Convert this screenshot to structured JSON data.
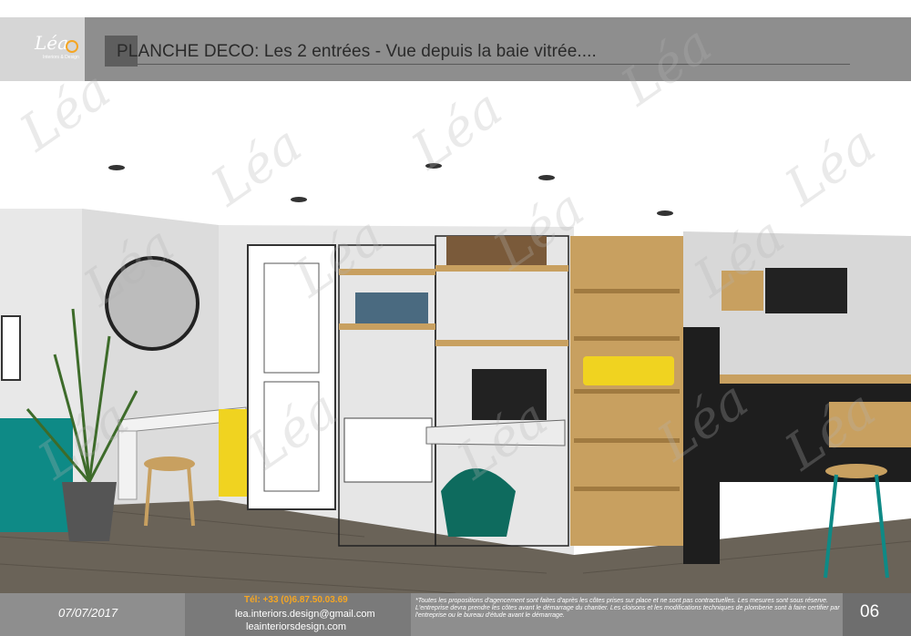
{
  "logo": {
    "mark": "Léa",
    "sub": "Interiors & Design"
  },
  "header": {
    "title": "PLANCHE DECO: Les 2 entrées - Vue depuis la baie vitrée...."
  },
  "footer": {
    "date": "07/07/2017",
    "tel": "Tél: +33 (0)6.87.50.03.69",
    "email": "lea.interiors.design@gmail.com",
    "website": "leainteriorsdesign.com",
    "note": "*Toutes les propositions d'agencement sont faites d'après les côtes prises sur place et ne sont pas contractuelles. Les mesures sont sous réserve. L'entreprise devra prendre les côtes avant le démarrage du chantier. Les cloisons et les modifications techniques de plomberie sont à faire certifier par l'entreprise ou le bureau d'étude avant le démarrage.",
    "page": "06"
  },
  "watermark": "Léa",
  "colors": {
    "header_gray": "#8e8e8e",
    "accent_orange": "#f5a623",
    "teal": "#0e8a86",
    "yellow": "#f0d320"
  }
}
